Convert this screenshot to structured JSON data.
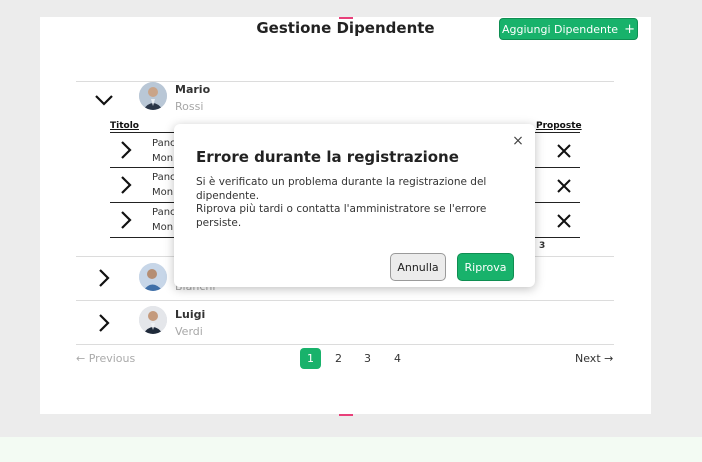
{
  "header": {
    "title": "Gestione Dipendente",
    "add_button_label": "Aggiungi Dipendente",
    "add_button_icon": "+"
  },
  "employees": [
    {
      "first_name": "Mario",
      "last_name": "Rossi",
      "expanded": true
    },
    {
      "first_name": "",
      "last_name": "Bianchi",
      "expanded": false
    },
    {
      "first_name": "Luigi",
      "last_name": "Verdi",
      "expanded": false
    }
  ],
  "subtable": {
    "headers": {
      "titolo": "Titolo",
      "proposte": "Proposte"
    },
    "rows": [
      {
        "line1": "Panc",
        "line2": "Mon"
      },
      {
        "line1": "Panc",
        "line2": "Mon"
      },
      {
        "line1": "Panc",
        "line2": "Mon"
      }
    ],
    "total": "3"
  },
  "pagination": {
    "previous_label": "Previous",
    "next_label": "Next",
    "pages": [
      "1",
      "2",
      "3",
      "4"
    ],
    "current_page": "1"
  },
  "modal": {
    "title": "Errore durante la registrazione",
    "body_line1": "Si è verificato un problema durante la registrazione del dipendente.",
    "body_line2": "Riprova più tardi o contatta l'amministratore se l'errore persiste.",
    "cancel_label": "Annulla",
    "retry_label": "Riprova",
    "close_icon": "×"
  },
  "colors": {
    "accent": "#18b26b",
    "page_bg": "#ececec",
    "card_bg": "#ffffff"
  }
}
